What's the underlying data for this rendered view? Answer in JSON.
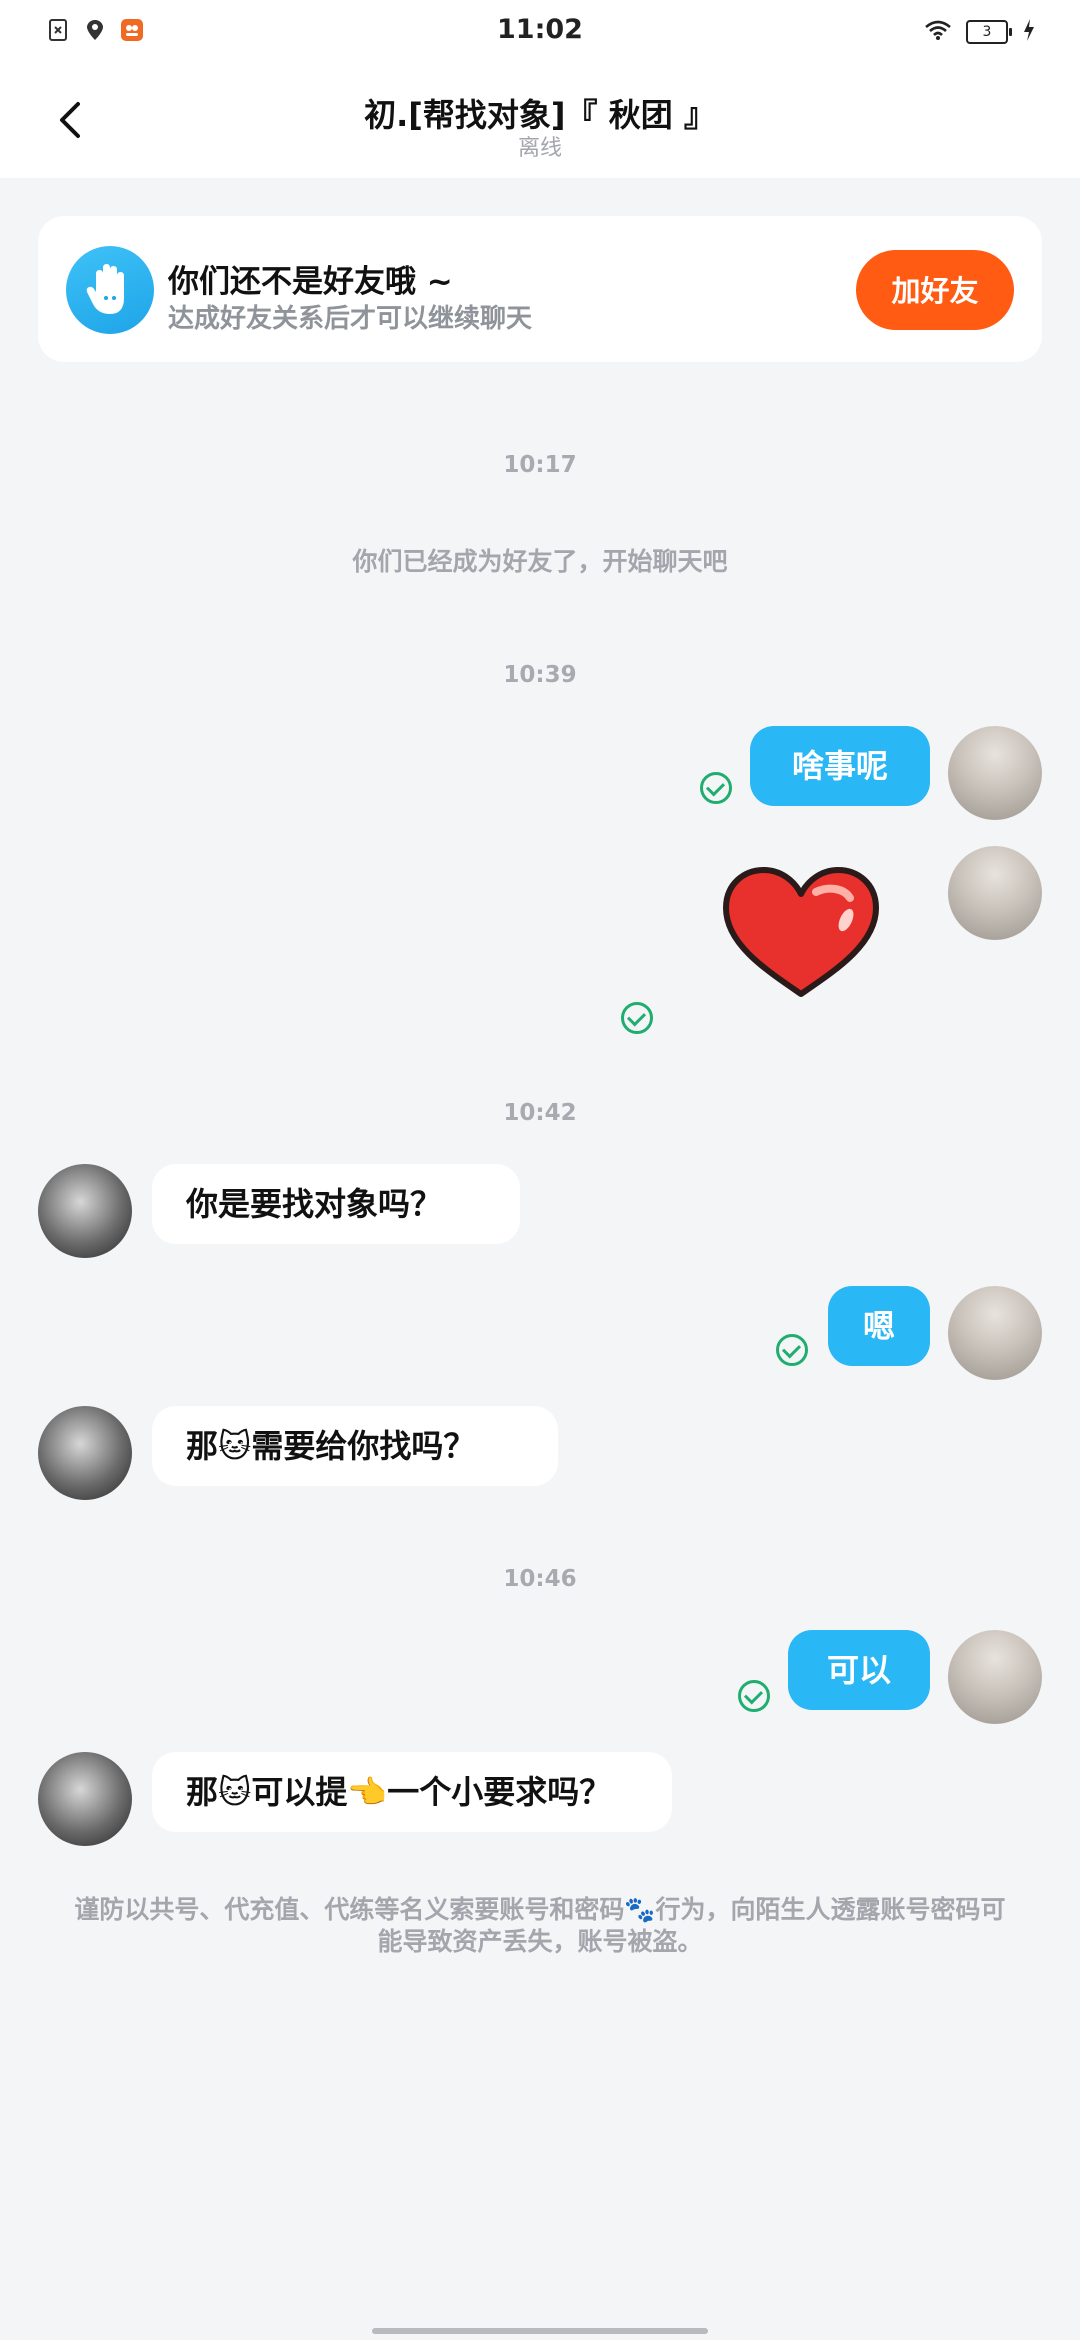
{
  "status_bar": {
    "time": "11:02",
    "battery": "3",
    "left_icons": [
      "sim-error-icon",
      "location-icon",
      "app-notification-icon"
    ],
    "right_icons": [
      "wifi-icon",
      "battery-icon",
      "charging-icon"
    ]
  },
  "header": {
    "title": "初.[帮找对象]『 秋团 』",
    "subtitle": "离线",
    "back_icon": "chevron-left-icon"
  },
  "friend_banner": {
    "title": "你们还不是好友哦 ~",
    "description": "达成好友关系后才可以继续聊天",
    "button_label": "加好友",
    "icon": "hand-wave-icon",
    "accent": "#ff5b12"
  },
  "chat": {
    "timestamps": [
      "10:17",
      "10:39",
      "10:42",
      "10:46"
    ],
    "system_message": "你们已经成为好友了，开始聊天吧",
    "messages": [
      {
        "direction": "out",
        "text": "啥事呢"
      },
      {
        "direction": "out",
        "type": "sticker",
        "sticker": "red-heart-sticker"
      },
      {
        "direction": "in",
        "text": "你是要找对象吗？"
      },
      {
        "direction": "out",
        "text": "嗯"
      },
      {
        "direction": "in",
        "text": "那🐱需要给你找吗？"
      },
      {
        "direction": "out",
        "text": "可以"
      },
      {
        "direction": "in",
        "text": "那🐱可以提👈一个小要求吗？"
      }
    ],
    "warning": "谨防以共号、代充值、代练等名义索要账号和密码🐾行为，向陌生人透露账号密码可能导致资产丢失，账号被盗。"
  },
  "colors": {
    "outgoing_bubble": "#2ab7f5",
    "read_check": "#1fae6f",
    "background": "#f4f5f7"
  }
}
